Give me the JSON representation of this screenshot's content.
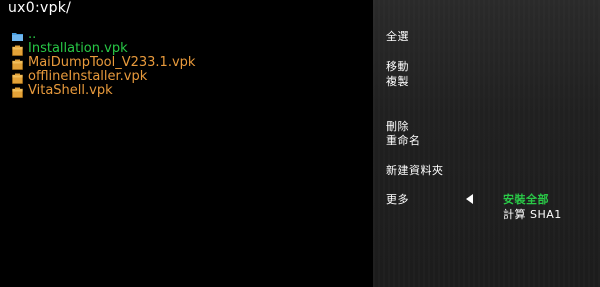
{
  "header": {
    "path": "ux0:vpk/"
  },
  "files": [
    {
      "name": "..",
      "type": "folder",
      "color": "#28c846",
      "icon": "folder-icon"
    },
    {
      "name": "Installation.vpk",
      "type": "file",
      "color": "#28c846",
      "icon": "package-icon"
    },
    {
      "name": "MaiDumpTool_V233.1.vpk",
      "type": "file",
      "color": "#e89a3c",
      "icon": "package-icon"
    },
    {
      "name": "offlineInstaller.vpk",
      "type": "file",
      "color": "#e89a3c",
      "icon": "package-icon"
    },
    {
      "name": "VitaShell.vpk",
      "type": "file",
      "color": "#e89a3c",
      "icon": "package-icon"
    }
  ],
  "context_menu": {
    "select_all": "全選",
    "move": "移動",
    "copy": "複製",
    "delete": "刪除",
    "rename": "重命名",
    "new_folder": "新建資料夾",
    "more": "更多"
  },
  "submenu": {
    "install_all": "安裝全部",
    "calculate_sha1": "計算 SHA1",
    "highlight_color": "#28c846",
    "default_color": "#ffffff"
  }
}
